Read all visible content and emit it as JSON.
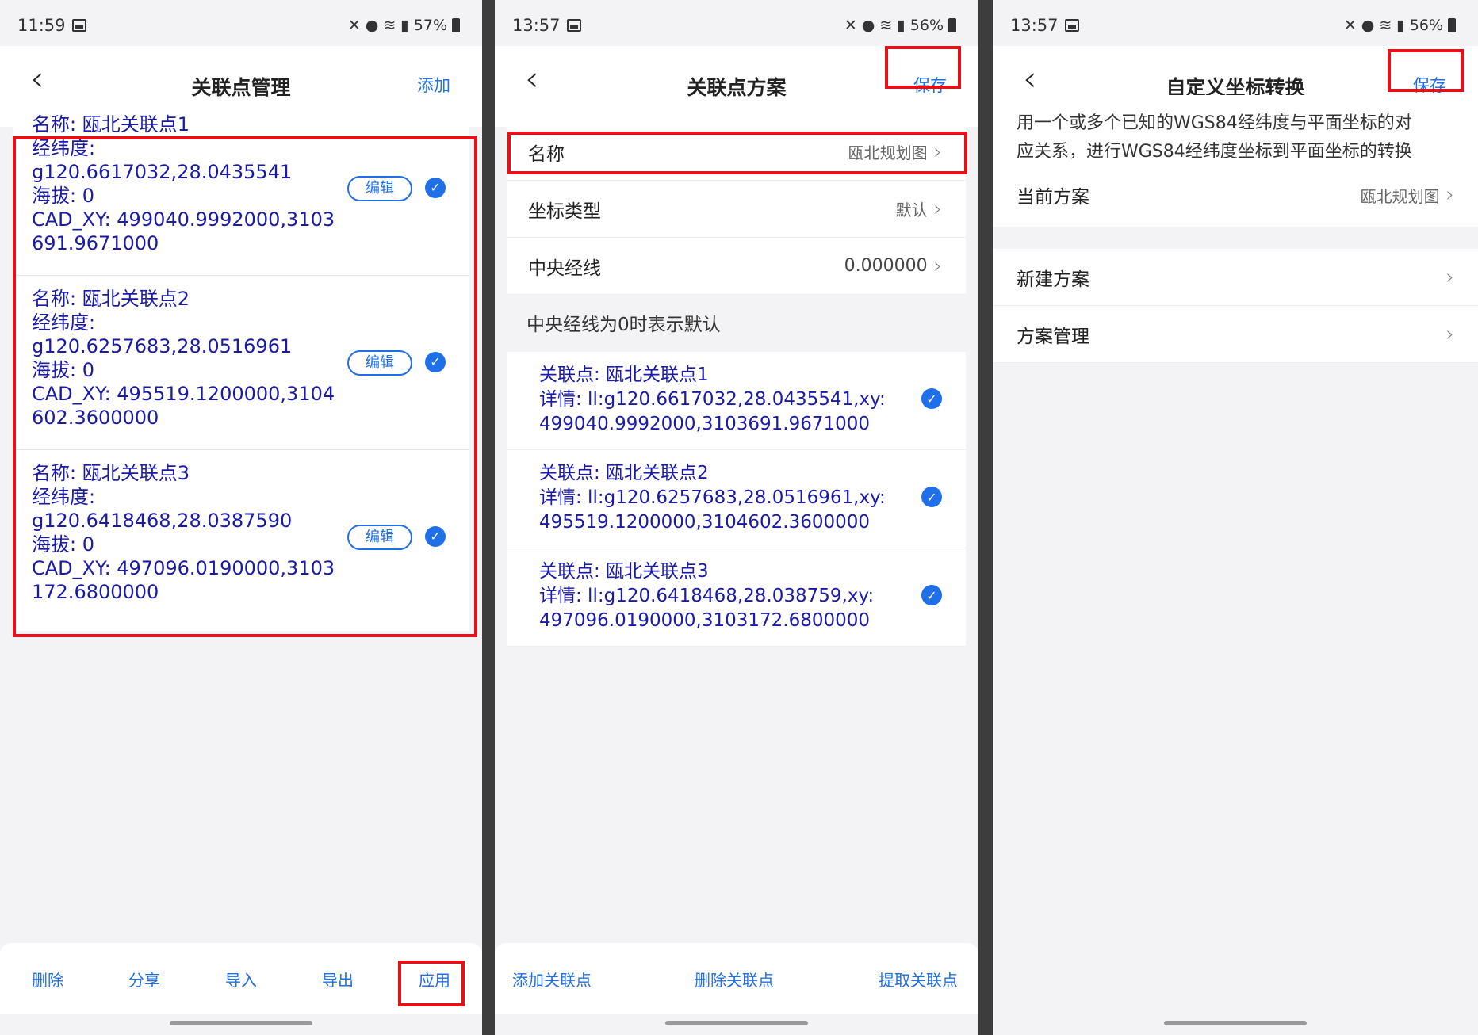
{
  "panel1": {
    "time": "11:59",
    "battery": "57%",
    "title": "关联点管理",
    "action": "添加",
    "points": [
      {
        "name": "名称: 瓯北关联点1",
        "lonlat_label": "经纬度:",
        "lonlat": "g120.6617032,28.0435541",
        "alt": "海拔: 0",
        "cad1": "CAD_XY: 499040.9992000,3103",
        "cad2": "691.9671000",
        "edit": "编辑"
      },
      {
        "name": "名称: 瓯北关联点2",
        "lonlat_label": "经纬度:",
        "lonlat": "g120.6257683,28.0516961",
        "alt": "海拔: 0",
        "cad1": "CAD_XY: 495519.1200000,3104",
        "cad2": "602.3600000",
        "edit": "编辑"
      },
      {
        "name": "名称: 瓯北关联点3",
        "lonlat_label": "经纬度:",
        "lonlat": "g120.6418468,28.0387590",
        "alt": "海拔: 0",
        "cad1": "CAD_XY: 497096.0190000,3103",
        "cad2": "172.6800000",
        "edit": "编辑"
      }
    ],
    "toolbar": [
      "删除",
      "分享",
      "导入",
      "导出",
      "应用"
    ]
  },
  "panel2": {
    "time": "13:57",
    "battery": "56%",
    "title": "关联点方案",
    "action": "保存",
    "rows": [
      {
        "label": "名称",
        "value": "瓯北规划图"
      },
      {
        "label": "坐标类型",
        "value": "默认"
      },
      {
        "label": "中央经线",
        "value": "0.000000"
      }
    ],
    "hint": "中央经线为0时表示默认",
    "links": [
      {
        "title": "关联点: 瓯北关联点1",
        "detail1": "详情: ll:g120.6617032,28.0435541,xy:",
        "detail2": "499040.9992000,3103691.9671000"
      },
      {
        "title": "关联点: 瓯北关联点2",
        "detail1": "详情: ll:g120.6257683,28.0516961,xy:",
        "detail2": "495519.1200000,3104602.3600000"
      },
      {
        "title": "关联点: 瓯北关联点3",
        "detail1": "详情: ll:g120.6418468,28.038759,xy:",
        "detail2": "497096.0190000,3103172.6800000"
      }
    ],
    "toolbar": [
      "添加关联点",
      "删除关联点",
      "提取关联点"
    ]
  },
  "panel3": {
    "time": "13:57",
    "battery": "56%",
    "title": "自定义坐标转换",
    "action": "保存",
    "desc1": "用一个或多个已知的WGS84经纬度与平面坐标的对",
    "desc2": "应关系，进行WGS84经纬度坐标到平面坐标的转换",
    "current_label": "当前方案",
    "current_value": "瓯北规划图",
    "menu": [
      "新建方案",
      "方案管理"
    ]
  },
  "icons": {
    "back": "‹",
    "chevron": "›",
    "check": "✓"
  },
  "colors": {
    "accent": "#1f6fe8",
    "highlight": "#e0131b",
    "point_text": "#1a1aa8"
  }
}
